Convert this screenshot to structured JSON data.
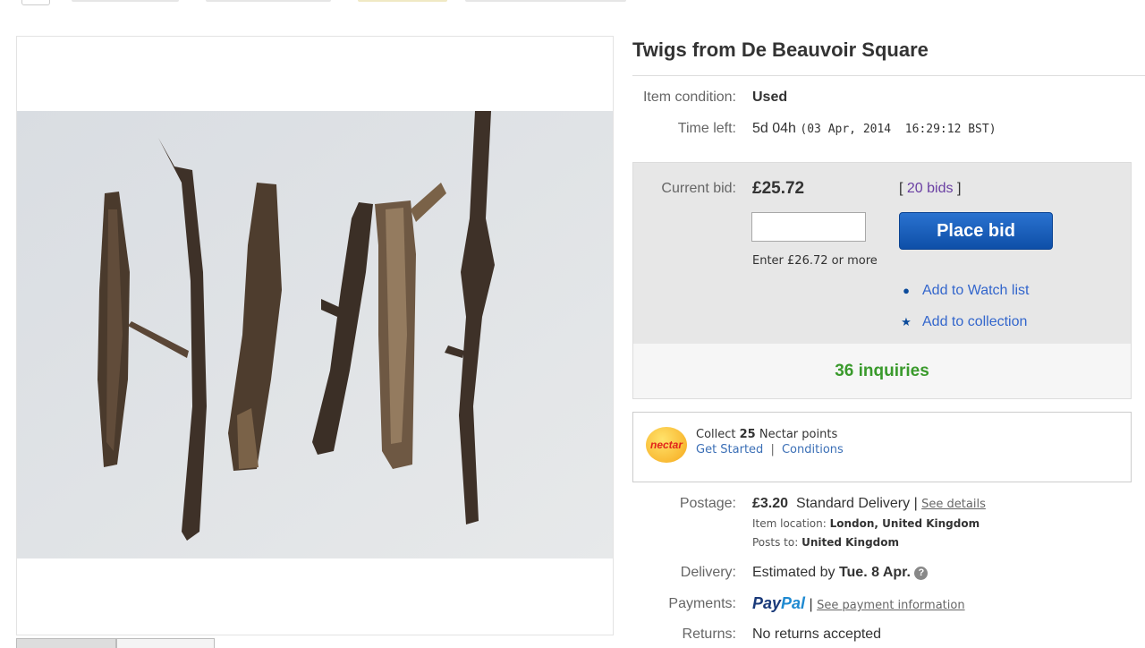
{
  "item": {
    "title": "Twigs from De Beauvoir Square",
    "condition_label": "Item condition:",
    "condition_value": "Used",
    "time_left_label": "Time left:",
    "time_left_value": "5d 04h",
    "time_left_end": "(03 Apr, 2014  16:29:12 BST)"
  },
  "bid": {
    "current_label": "Current bid:",
    "current_value": "£25.72",
    "bids_open": "[",
    "bids_link": "20 bids",
    "bids_close": "]",
    "input_value": "",
    "enter_hint": "Enter £26.72 or more",
    "place_bid_label": "Place bid",
    "watch_label": "Add to Watch list",
    "collection_label": "Add to collection",
    "inquiries": "36 inquiries"
  },
  "nectar": {
    "logo": "nectar",
    "collect_prefix": "Collect",
    "points": "25",
    "collect_suffix": "Nectar points",
    "get_started": "Get Started",
    "separator": "|",
    "conditions": "Conditions"
  },
  "postage": {
    "label": "Postage:",
    "price": "£3.20",
    "method": "Standard Delivery",
    "separator": "|",
    "details_link": "See details",
    "location_label": "Item location:",
    "location_value": "London, United Kingdom",
    "posts_label": "Posts to:",
    "posts_value": "United Kingdom"
  },
  "delivery": {
    "label": "Delivery:",
    "prefix": "Estimated by",
    "date": "Tue. 8 Apr.",
    "help": "?"
  },
  "payments": {
    "label": "Payments:",
    "paypal_a": "Pay",
    "paypal_b": "Pal",
    "separator": "|",
    "info_link": "See payment information"
  },
  "returns": {
    "label": "Returns:",
    "value": "No returns accepted"
  },
  "colors": {
    "place_bid": "#0e4fa8",
    "inquiries": "#3a9a2c",
    "link": "#3366cc",
    "bid_box": "#e7e7e7"
  },
  "icons": {
    "watch": "eye-icon",
    "collection": "star-icon",
    "help": "help-icon"
  }
}
